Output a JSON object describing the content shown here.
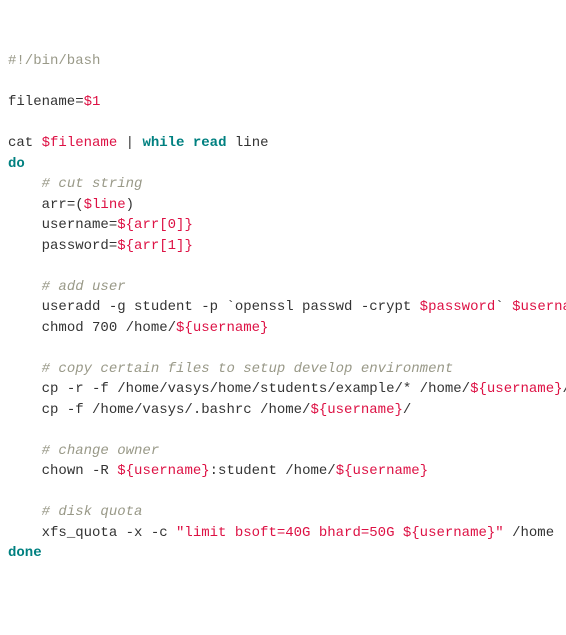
{
  "code": {
    "shebang": "#!/bin/bash",
    "assign_filename_lhs": "filename=",
    "assign_filename_rhs": "$1",
    "cat": "cat ",
    "filename_var": "$filename",
    "pipe": " | ",
    "while": "while",
    "sp": " ",
    "read": "read",
    "line": " line",
    "do": "do",
    "cmt_cut": "# cut string",
    "arr_lhs": "arr=(",
    "line_var": "$line",
    "arr_rhs": ")",
    "username_lhs": "username=",
    "arr0": "${arr[0]}",
    "password_lhs": "password=",
    "arr1": "${arr[1]}",
    "cmt_add": "# add user",
    "useradd_a": "useradd -g student -p `openssl passwd -crypt ",
    "password_var": "$password",
    "useradd_b": "` ",
    "username_var": "$username",
    "chmod_a": "chmod 700 /home/",
    "exp_user": "${username}",
    "cmt_copy": "# copy certain files to setup develop environment",
    "cp1_a": "cp -r -f /home/vasys/home/students/example/* /home/",
    "cp1_b": "/",
    "cp2_a": "cp -f /home/vasys/.bashrc /home/",
    "cp2_b": "/",
    "cmt_owner": "# change owner",
    "chown_a": "chown -R ",
    "chown_b": ":student /home/",
    "cmt_quota": "# disk quota",
    "xfs_a": "xfs_quota -x -c ",
    "xfs_str_a": "\"limit bsoft=40G bhard=50G ",
    "xfs_str_b": "\"",
    "xfs_b": " /home",
    "done": "done"
  }
}
